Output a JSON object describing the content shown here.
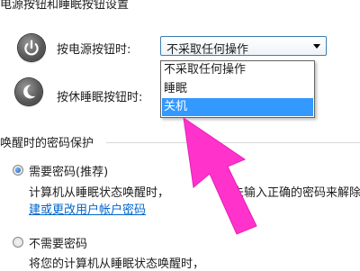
{
  "power_buttons_section": {
    "title": "电源按钮和睡眠按钮设置",
    "power_button_label": "按电源按钮时:",
    "sleep_button_label": "按休睡眠按钮时:",
    "power_button_icon": "power-icon",
    "sleep_button_icon": "moon-icon",
    "selected_value": "不采取任何操作",
    "options": [
      "不采取任何操作",
      "睡眠",
      "关机"
    ],
    "highlighted_option": "关机"
  },
  "wake_password_section": {
    "title": "唤醒时的密码保护",
    "require_password": {
      "label": "需要密码(推荐)",
      "checked": true,
      "description_part1": "计算机从睡眠状态唤醒时，",
      "description_part2": "未输入正确的密码来解除",
      "link_text": "建或更改用户帐户密码"
    },
    "no_password": {
      "label": "不需要密码",
      "checked": false,
      "description": "将您的计算机从睡眠状态唤醒时，"
    }
  },
  "colors": {
    "selection": "#3399ff",
    "link": "#0066cc",
    "annotation_arrow": "#ff33cc"
  }
}
